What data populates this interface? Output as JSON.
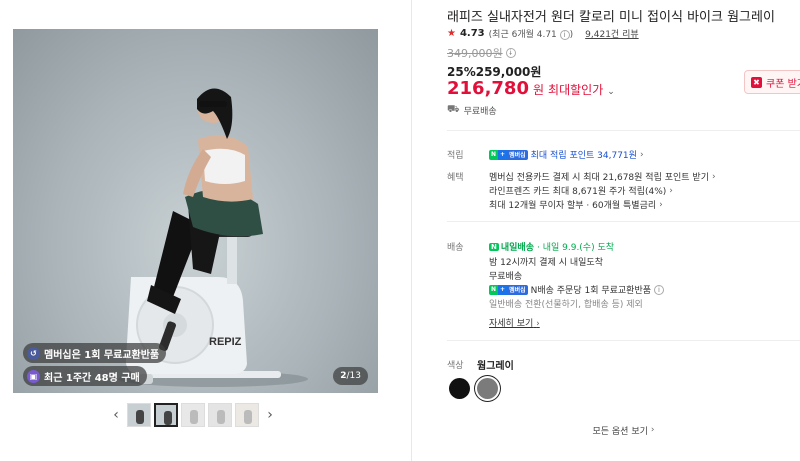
{
  "gallery": {
    "brand_mark": "REPIZ",
    "badge_membership": "멤버십은 1회 무료교환반품",
    "badge_recent": "최근 1주간 48명 구매",
    "page_current": "2",
    "page_total": "/13",
    "thumb_count": 5,
    "active_thumb": 2
  },
  "product": {
    "title": "래피즈 실내자전거 원더 칼로리 미니 접이식 바이크 웜그레이",
    "rating": "4.73",
    "rating_detail": "(최근 6개월 4.71",
    "review_count": "9,421건 리뷰",
    "original_price": "349,000원",
    "discount_rate": "25%",
    "sale_price": "259,000원",
    "max_discount_price": "216,780",
    "max_discount_unit": "원",
    "max_discount_label": "최대할인가",
    "coupon_label": "쿠폰 받기",
    "free_shipping": "무료배송"
  },
  "benefits": {
    "points_label": "적립",
    "points_badge_n": "N",
    "points_badge_plus": "+",
    "points_badge_m": "멤버십",
    "points_text": "최대 적립 포인트 34,771원",
    "perks_label": "혜택",
    "perk_1": "멤버십 전용카드 결제 시 최대 21,678원 적립 포인트 받기",
    "perk_2": "라인프렌즈 카드 최대 8,671원 주가 적립(4%)",
    "perk_3": "최대 12개월 무이자 할부 · 60개월 특별금리"
  },
  "shipping": {
    "label": "배송",
    "tomorrow_badge": "N",
    "tomorrow_label": "내일배송",
    "tomorrow_date": "· 내일 9.9.(수) 도착",
    "cutoff": "밤 12시까지 결제 시 내일도착",
    "free": "무료배송",
    "n_return": "N배송 주문당 1회 무료교환반품",
    "exception": "일반배송 전환(선물하기, 합배송 등) 제외",
    "detail_link": "자세히 보기"
  },
  "options": {
    "color_label": "색상",
    "color_selected": "웜그레이",
    "more_options": "모든 옵션 보기"
  },
  "colors": {
    "accent_red": "#e0103a",
    "npay_green": "#03c75a",
    "point_blue": "#1a50d0"
  }
}
